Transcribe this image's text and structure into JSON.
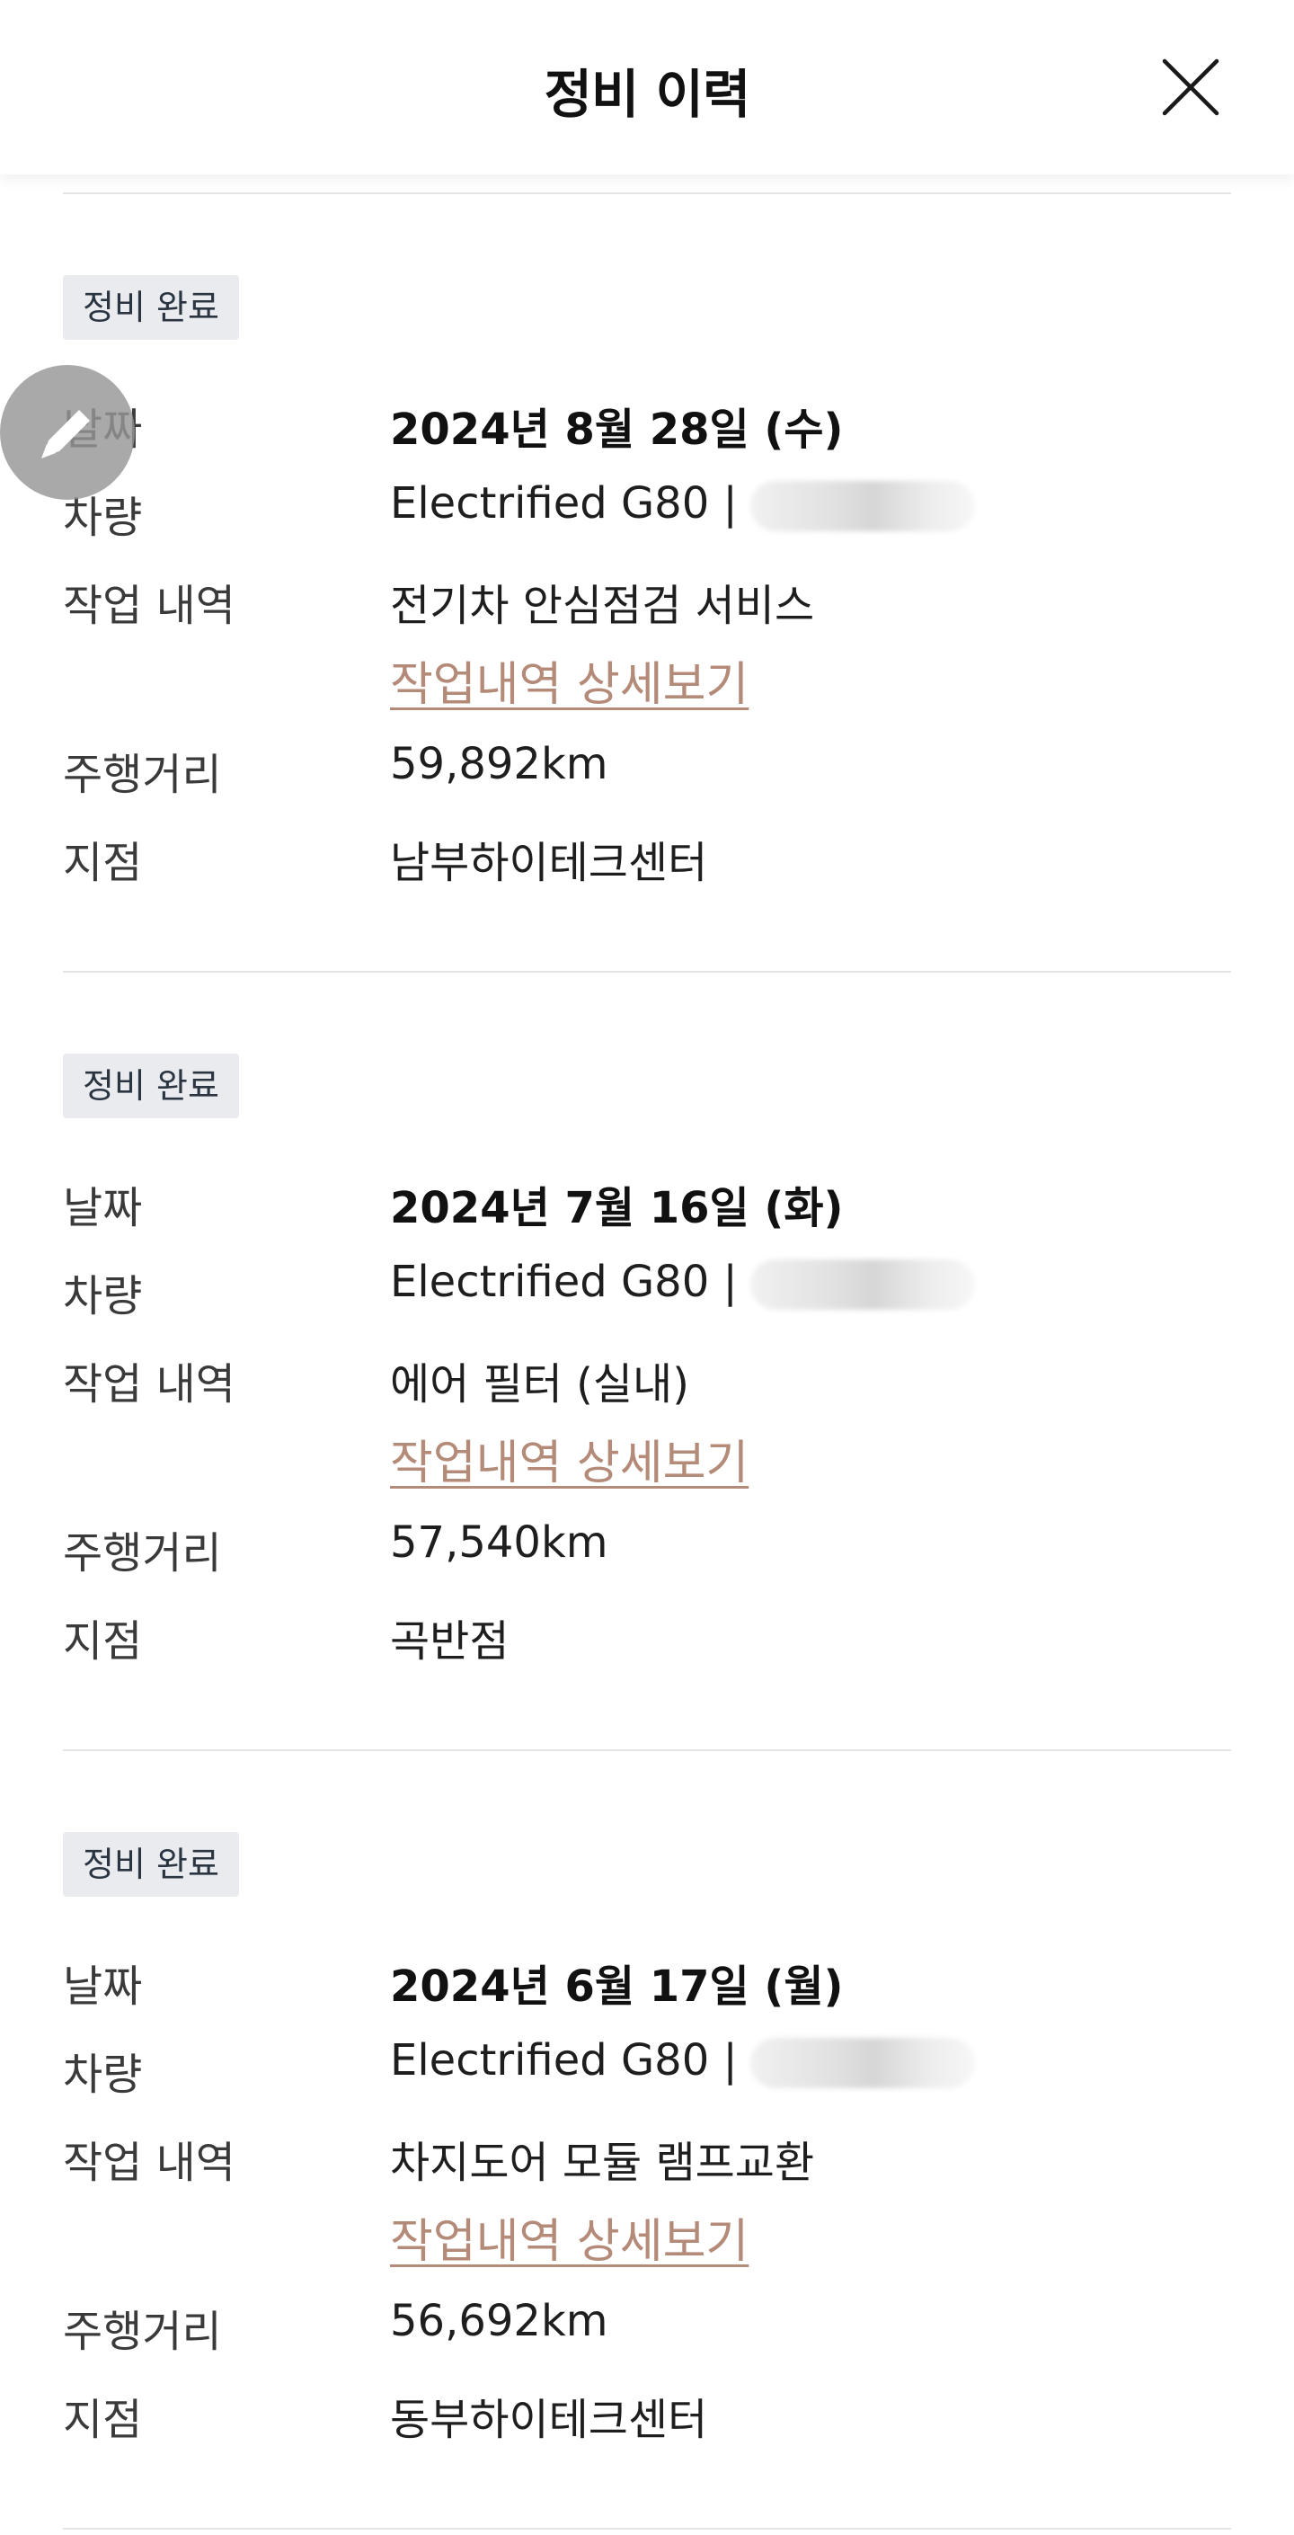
{
  "header": {
    "title": "정비 이력"
  },
  "records": [
    {
      "badge": "정비 완료",
      "date_label": "날짜",
      "date": "2024년 8월 28일 (수)",
      "vehicle_label": "차량",
      "vehicle": "Electrified G80  |",
      "work_label": "작업 내역",
      "work": "전기차 안심점검 서비스",
      "detail_link": "작업내역 상세보기",
      "mileage_label": "주행거리",
      "mileage": "59,892km",
      "branch_label": "지점",
      "branch": "남부하이테크센터"
    },
    {
      "badge": "정비 완료",
      "date_label": "날짜",
      "date": "2024년 7월 16일 (화)",
      "vehicle_label": "차량",
      "vehicle": "Electrified G80  |",
      "work_label": "작업 내역",
      "work": "에어 필터 (실내)",
      "detail_link": "작업내역 상세보기",
      "mileage_label": "주행거리",
      "mileage": "57,540km",
      "branch_label": "지점",
      "branch": "곡반점"
    },
    {
      "badge": "정비 완료",
      "date_label": "날짜",
      "date": "2024년 6월 17일 (월)",
      "vehicle_label": "차량",
      "vehicle": "Electrified G80  |",
      "work_label": "작업 내역",
      "work": "차지도어 모듈 램프교환",
      "detail_link": "작업내역 상세보기",
      "mileage_label": "주행거리",
      "mileage": "56,692km",
      "branch_label": "지점",
      "branch": "동부하이테크센터"
    }
  ],
  "icons": {
    "close": "close-icon",
    "fab": "pencil-icon"
  },
  "colors": {
    "link": "#b48a78",
    "badge_bg": "#e9ebee",
    "divider": "#e4e4e4"
  }
}
